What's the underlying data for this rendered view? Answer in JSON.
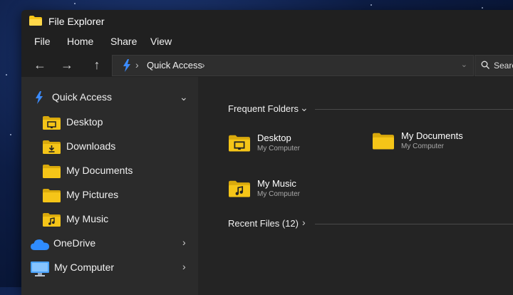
{
  "window": {
    "title": "File Explorer"
  },
  "menu": [
    "File",
    "Home",
    "Share",
    "View"
  ],
  "address": {
    "path": "Quick Access",
    "search_placeholder": "Search"
  },
  "sidebar": {
    "quick_access": "Quick Access",
    "items": [
      {
        "label": "Desktop",
        "icon": "desktop-folder-icon"
      },
      {
        "label": "Downloads",
        "icon": "downloads-folder-icon"
      },
      {
        "label": "My Documents",
        "icon": "folder-icon"
      },
      {
        "label": "My Pictures",
        "icon": "folder-icon"
      },
      {
        "label": "My Music",
        "icon": "music-folder-icon"
      }
    ],
    "onedrive": "OneDrive",
    "my_computer": "My Computer"
  },
  "main": {
    "frequent_title": "Frequent Folders",
    "folders": [
      {
        "name": "Desktop",
        "location": "My Computer",
        "icon": "desktop-folder-icon"
      },
      {
        "name": "My Documents",
        "location": "My Computer",
        "icon": "folder-icon"
      },
      {
        "name": "My Music",
        "location": "My Computer",
        "icon": "music-folder-icon"
      }
    ],
    "recent_title": "Recent Files (12)"
  },
  "colors": {
    "folder": "#f5c518",
    "accent": "#3b8bff",
    "window_bg": "#2b2b2b"
  }
}
